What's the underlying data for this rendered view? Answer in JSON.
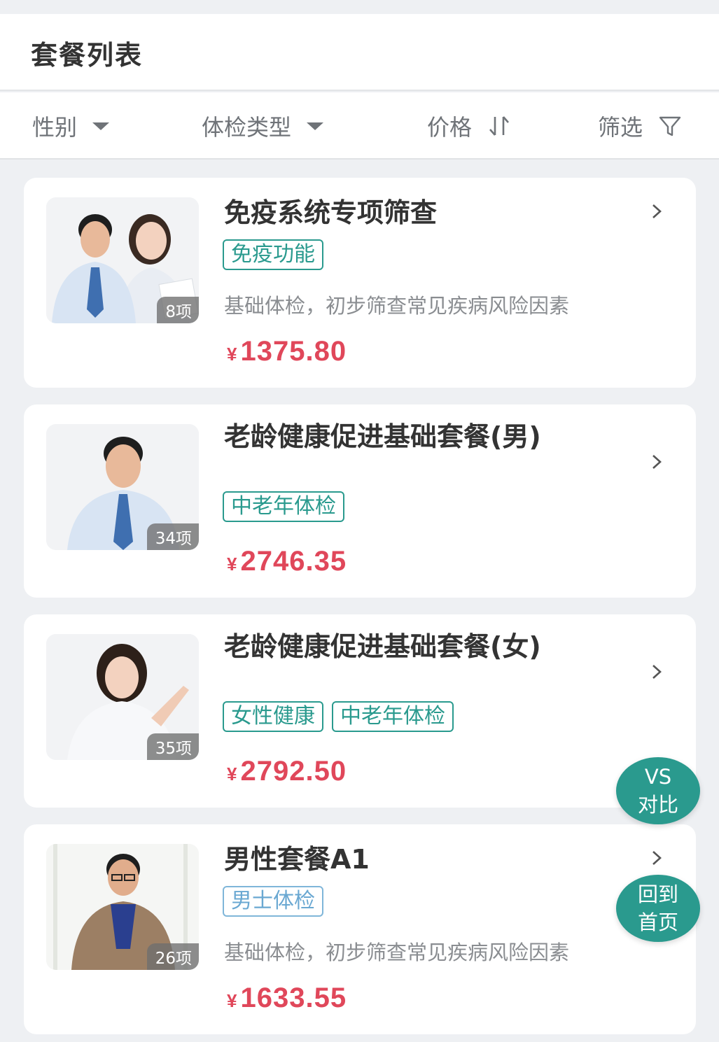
{
  "header": {
    "title": "套餐列表"
  },
  "filters": [
    {
      "label": "性别",
      "icon": "caret-down-icon"
    },
    {
      "label": "体检类型",
      "icon": "caret-down-icon"
    },
    {
      "label": "价格",
      "icon": "sort-icon"
    },
    {
      "label": "筛选",
      "icon": "funnel-icon"
    }
  ],
  "packages": [
    {
      "title": "免疫系统专项筛查",
      "tags": [
        {
          "text": "免疫功能",
          "color": "#2a9a8e"
        }
      ],
      "description": "基础体检，初步筛查常见疾病风险因素",
      "currency": "¥",
      "price": "1375.80",
      "item_count": "8项"
    },
    {
      "title": "老龄健康促进基础套餐(男)",
      "tags": [
        {
          "text": "中老年体检",
          "color": "#2a9a8e"
        }
      ],
      "description": "",
      "currency": "¥",
      "price": "2746.35",
      "item_count": "34项"
    },
    {
      "title": "老龄健康促进基础套餐(女)",
      "tags": [
        {
          "text": "女性健康",
          "color": "#2a9a8e"
        },
        {
          "text": "中老年体检",
          "color": "#2a9a8e"
        }
      ],
      "description": "",
      "currency": "¥",
      "price": "2792.50",
      "item_count": "35项"
    },
    {
      "title": "男性套餐A1",
      "tags": [
        {
          "text": "男士体检",
          "color": "#6aa8d2"
        }
      ],
      "description": "基础体检，初步筛查常见疾病风险因素",
      "currency": "¥",
      "price": "1633.55",
      "item_count": "26项"
    }
  ],
  "floating": {
    "compare": {
      "line1": "VS",
      "line2": "对比"
    },
    "home": {
      "line1": "回到",
      "line2": "首页"
    }
  },
  "colors": {
    "accent": "#2a9a8e",
    "price": "#e0475a",
    "background": "#eef0f3"
  }
}
